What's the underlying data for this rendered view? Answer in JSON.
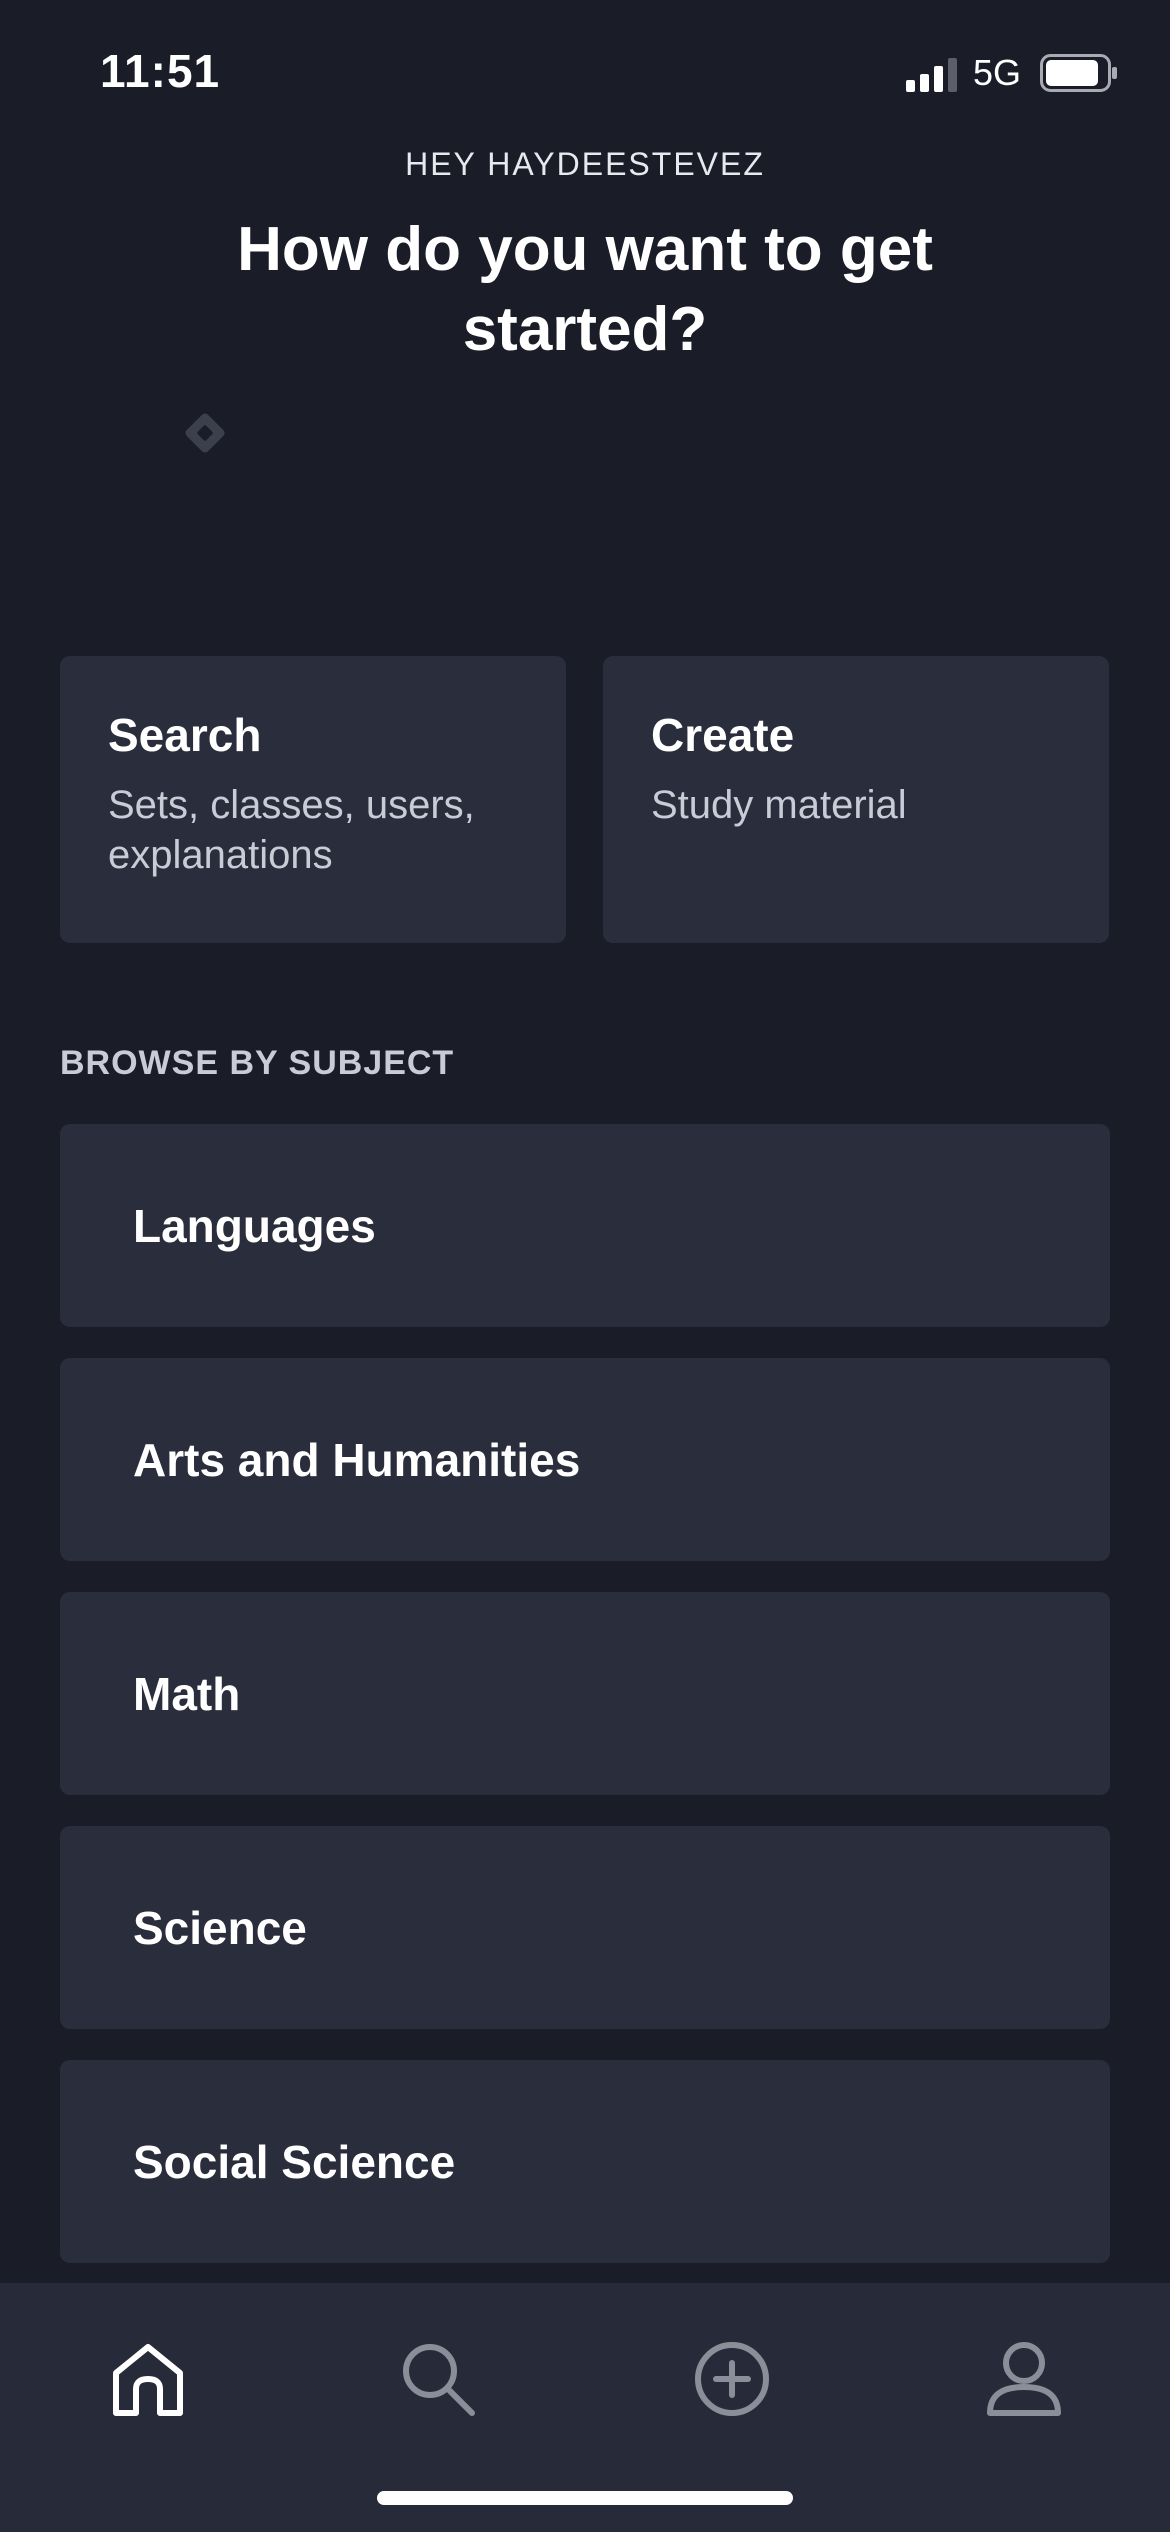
{
  "status_bar": {
    "time": "11:51",
    "network": "5G"
  },
  "header": {
    "greeting": "HEY HAYDEESTEVEZ",
    "title": "How do you want to get started?"
  },
  "cards": [
    {
      "title": "Search",
      "subtitle": "Sets, classes, users, explanations"
    },
    {
      "title": "Create",
      "subtitle": "Study material"
    }
  ],
  "browse": {
    "label": "BROWSE BY SUBJECT",
    "subjects": [
      "Languages",
      "Arts and Humanities",
      "Math",
      "Science",
      "Social Science"
    ]
  },
  "tab_bar": {
    "items": [
      "home-icon",
      "search-icon",
      "add-circle-icon",
      "profile-icon"
    ]
  },
  "colors": {
    "background": "#1a1d28",
    "card": "#2a2d3b",
    "tab_bar": "#272a38",
    "muted_text": "#c9ccd6"
  }
}
